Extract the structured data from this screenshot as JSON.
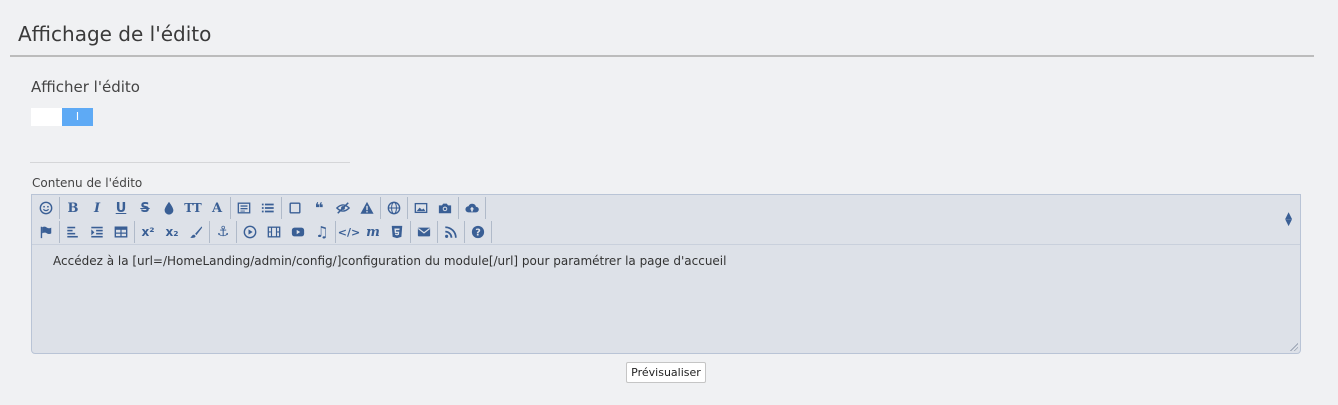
{
  "section": {
    "title": "Affichage de l'édito"
  },
  "display_field": {
    "label": "Afficher l'édito",
    "toggle_on_text": "I",
    "state": "on",
    "on_color": "#5eaaf5"
  },
  "content_field": {
    "label": "Contenu de l'édito"
  },
  "editor": {
    "value": "Accédez à la [url=/HomeLanding/admin/config/]configuration du module[/url] pour paramétrer la page d'accueil",
    "toolbar_row1": [
      "smiley-icon",
      "bold-icon",
      "italic-icon",
      "underline-icon",
      "strikethrough-icon",
      "color-drop-icon",
      "font-size-icon",
      "font-icon",
      "list-box-icon",
      "list-icon",
      "block-icon",
      "quote-icon",
      "hide-icon",
      "warning-icon",
      "globe-icon",
      "image-icon",
      "camera-icon",
      "cloud-upload-icon"
    ],
    "toolbar_row2": [
      "flag-icon",
      "align-left-icon",
      "indent-icon",
      "table-icon",
      "superscript-icon",
      "subscript-icon",
      "brush-icon",
      "anchor-icon",
      "play-icon",
      "film-icon",
      "youtube-icon",
      "music-icon",
      "code-icon",
      "math-icon",
      "html5-icon",
      "mail-icon",
      "rss-icon",
      "help-icon"
    ],
    "glyphs": {
      "bold": "B",
      "italic": "I",
      "underline": "U",
      "strike": "S",
      "fontsize": "TT",
      "font": "A",
      "sup": "x²",
      "sub": "x₂",
      "quote": "❝",
      "anchor": "⚓",
      "music": "♫",
      "code": "</>",
      "math": "m",
      "help": "?",
      "warning": "!"
    },
    "toolbar_color": "#3a5f95",
    "background": "#dde1e8"
  },
  "preview_button": {
    "label": "Prévisualiser"
  }
}
